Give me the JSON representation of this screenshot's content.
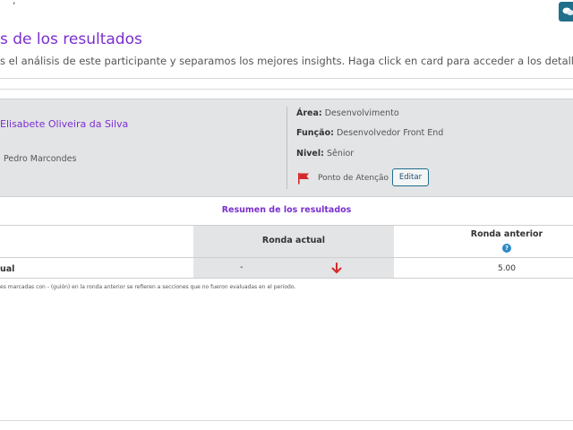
{
  "page": {
    "title": "s de los resultados",
    "subtitle": "s el análisis de este participante y separamos los mejores insights. Haga click en card para acceder a los detalles."
  },
  "participant": {
    "name": "Elisabete Oliveira da Silva",
    "manager": "Pedro Marcondes",
    "area_label": "Área:",
    "area_value": "Desenvolvimento",
    "role_label": "Função:",
    "role_value": "Desenvolvedor Front End",
    "level_label": "Nivel:",
    "level_value": "Sênior",
    "attention_label": "Ponto de Atenção",
    "edit_label": "Editar"
  },
  "summary": {
    "title": "Resumen de los resultados",
    "col_current": "Ronda actual",
    "col_previous": "Ronda anterior",
    "help_glyph": "?",
    "rows": [
      {
        "label": "ual",
        "current": "-",
        "trend": "down",
        "previous": "5.00"
      }
    ],
    "footnote": "es marcadas con - (guión) en la ronda anterior se refieren a secciones que no fueron evaluadas en el periodo."
  },
  "icons": {
    "chat": "chat-bubbles-icon",
    "flag": "flag-icon",
    "trend_down": "arrow-down-icon",
    "help": "question-circle-icon"
  },
  "colors": {
    "accent": "#7a2fcf",
    "teal": "#1f6f8b",
    "flag": "#d42a2a",
    "trend_down": "#d42a2a",
    "help": "#2a88c8",
    "card_bg": "#e3e4e6"
  }
}
